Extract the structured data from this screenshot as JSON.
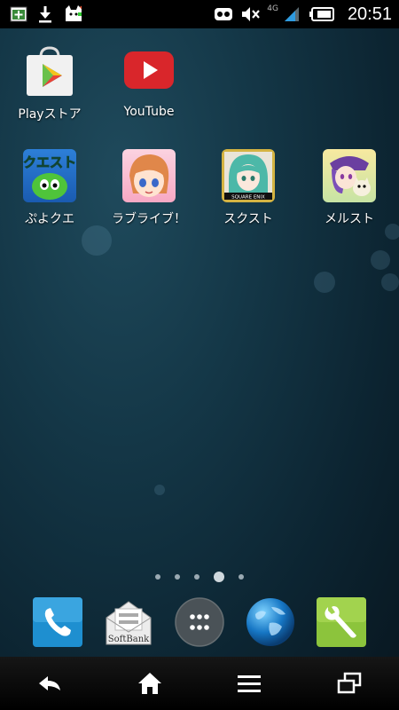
{
  "status_bar": {
    "time": "20:51",
    "network": "4G",
    "icons": [
      "add-icon",
      "download-icon",
      "notification-mascot-icon",
      "game-controller-icon",
      "mute-icon",
      "signal-icon",
      "battery-icon"
    ]
  },
  "apps": [
    {
      "name": "play-store",
      "label": "Playストア",
      "icon": "play-store-icon"
    },
    {
      "name": "youtube",
      "label": "YouTube",
      "icon": "youtube-icon"
    },
    {
      "name": "puyo-quest",
      "label": "ぷよクエ",
      "icon": "puyo-quest-icon",
      "icon_text": "クエスト"
    },
    {
      "name": "love-live",
      "label": "ラブライブ！",
      "icon": "love-live-icon"
    },
    {
      "name": "scast",
      "label": "スクスト",
      "icon": "scast-icon",
      "icon_text": "SQUARE ENIX"
    },
    {
      "name": "merc-storia",
      "label": "メルスト",
      "icon": "merc-storia-icon"
    }
  ],
  "page_indicator": {
    "pages": 5,
    "current": 4
  },
  "dock": [
    {
      "name": "phone",
      "icon": "phone-icon"
    },
    {
      "name": "softbank-mail",
      "icon": "mail-icon",
      "icon_text": "SoftBank"
    },
    {
      "name": "app-drawer",
      "icon": "app-drawer-icon"
    },
    {
      "name": "browser",
      "icon": "globe-icon"
    },
    {
      "name": "tools",
      "icon": "wrench-icon"
    }
  ],
  "nav_bar": [
    "back-icon",
    "home-icon",
    "menu-icon",
    "recent-apps-icon"
  ],
  "colors": {
    "youtube_red": "#d9262b",
    "phone_blue": "#1e8fd0",
    "tools_green": "#8cc43c"
  }
}
